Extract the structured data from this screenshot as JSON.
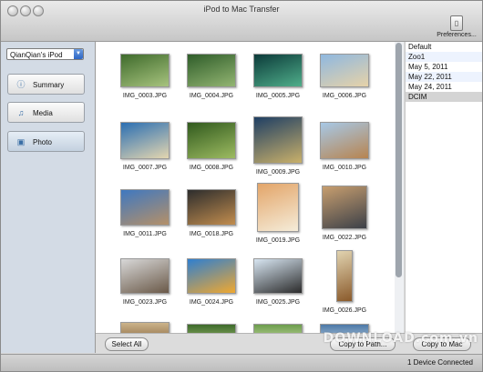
{
  "window": {
    "title": "iPod to Mac Transfer"
  },
  "toolbar": {
    "preferences_label": "Preferences..."
  },
  "sidebar": {
    "device": "QianQian's iPod",
    "items": [
      {
        "label": "Summary",
        "icon": "info-icon"
      },
      {
        "label": "Media",
        "icon": "music-note-icon"
      },
      {
        "label": "Photo",
        "icon": "photo-icon",
        "selected": true
      }
    ]
  },
  "photos": [
    {
      "name": "IMG_0003.JPG",
      "colors": [
        "#3f6b2c",
        "#a7c37e"
      ]
    },
    {
      "name": "IMG_0004.JPG",
      "colors": [
        "#2f5d2a",
        "#93b572"
      ]
    },
    {
      "name": "IMG_0005.JPG",
      "colors": [
        "#0c3b3a",
        "#4fae8a"
      ]
    },
    {
      "name": "IMG_0006.JPG",
      "colors": [
        "#8fb8e0",
        "#e6d2a8"
      ]
    },
    {
      "name": "IMG_0007.JPG",
      "colors": [
        "#2b6fb3",
        "#e4d6b0"
      ]
    },
    {
      "name": "IMG_0008.JPG",
      "colors": [
        "#315a1e",
        "#9dbb61"
      ]
    },
    {
      "name": "IMG_0009.JPG",
      "colors": [
        "#1f3f64",
        "#c9b06a"
      ]
    },
    {
      "name": "IMG_0010.JPG",
      "colors": [
        "#a7c8e6",
        "#b78450"
      ]
    },
    {
      "name": "IMG_0011.JPG",
      "colors": [
        "#3f78c0",
        "#b59068"
      ]
    },
    {
      "name": "IMG_0018.JPG",
      "colors": [
        "#2d2d2d",
        "#c28d4e"
      ]
    },
    {
      "name": "IMG_0019.JPG",
      "colors": [
        "#e3a569",
        "#f5ecd9"
      ]
    },
    {
      "name": "IMG_0022.JPG",
      "colors": [
        "#c79e6f",
        "#3c4048"
      ]
    },
    {
      "name": "IMG_0023.JPG",
      "colors": [
        "#d8d8d8",
        "#6a5948"
      ]
    },
    {
      "name": "IMG_0024.JPG",
      "colors": [
        "#2f7fd0",
        "#f0a830"
      ]
    },
    {
      "name": "IMG_0025.JPG",
      "colors": [
        "#d8e6f2",
        "#2b2b2b"
      ]
    },
    {
      "name": "IMG_0026.JPG",
      "colors": [
        "#e1d3b0",
        "#8a5a2b"
      ]
    }
  ],
  "folders": [
    {
      "label": "Default"
    },
    {
      "label": "Zoo1"
    },
    {
      "label": "May 5, 2011"
    },
    {
      "label": "May 22, 2011"
    },
    {
      "label": "May 24, 2011"
    },
    {
      "label": "DCIM",
      "selected": true
    }
  ],
  "buttons": {
    "select_all": "Select All",
    "copy_to_path": "Copy to Path...",
    "copy_to_mac": "Copy to Mac"
  },
  "status": {
    "text": "1 Device Connected"
  },
  "watermark": {
    "text": "DOWNLOAD.com.vn"
  }
}
